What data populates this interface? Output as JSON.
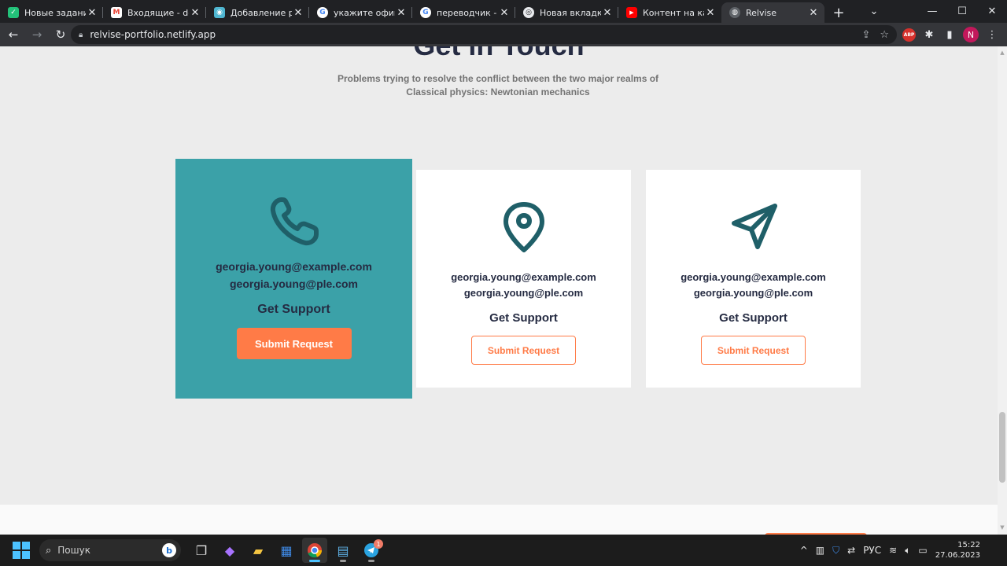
{
  "browser": {
    "tabs": [
      {
        "label": "Новые задания",
        "favicon_color": "#23c27a",
        "favicon_glyph": "✓"
      },
      {
        "label": "Входящие - devel",
        "favicon_color": "#ea4335",
        "favicon_glyph": "M"
      },
      {
        "label": "Добавление рабо",
        "favicon_color": "#4fb6d1",
        "favicon_glyph": "◉"
      },
      {
        "label": "укажите официал",
        "favicon_color": "#4285f4",
        "favicon_glyph": "G"
      },
      {
        "label": "переводчик - По",
        "favicon_color": "#4285f4",
        "favicon_glyph": "G"
      },
      {
        "label": "Новая вкладка",
        "favicon_color": "#5f6368",
        "favicon_glyph": "◎"
      },
      {
        "label": "Контент на канал",
        "favicon_color": "#ff0000",
        "favicon_glyph": "▶"
      },
      {
        "label": "Relvise",
        "favicon_color": "#5f6368",
        "favicon_glyph": "◍",
        "active": true
      }
    ],
    "url": "relvise-portfolio.netlify.app",
    "profile_initial": "N",
    "abp_label": "ABP"
  },
  "page": {
    "heading": "Get in Touch",
    "subtitle": "Problems trying to resolve the conflict between the two major realms of Classical physics: Newtonian mechanics",
    "cards": [
      {
        "icon": "phone-icon",
        "email1": "georgia.young@example.com",
        "email2": "georgia.young@ple.com",
        "support": "Get Support",
        "button": "Submit Request"
      },
      {
        "icon": "location-pin-icon",
        "email1": "georgia.young@example.com",
        "email2": "georgia.young@ple.com",
        "support": "Get Support",
        "button": "Submit Request"
      },
      {
        "icon": "send-icon",
        "email1": "georgia.young@example.com",
        "email2": "georgia.young@ple.com",
        "support": "Get Support",
        "button": "Submit Request"
      }
    ],
    "colors": {
      "teal": "#3ba1a8",
      "icon_teal": "#1f5f68",
      "orange": "#ff7b47",
      "navy": "#252b42"
    }
  },
  "taskbar": {
    "search_placeholder": "Пошук",
    "telegram_badge": "1",
    "language": "РУС",
    "time": "15:22",
    "date": "27.06.2023"
  }
}
